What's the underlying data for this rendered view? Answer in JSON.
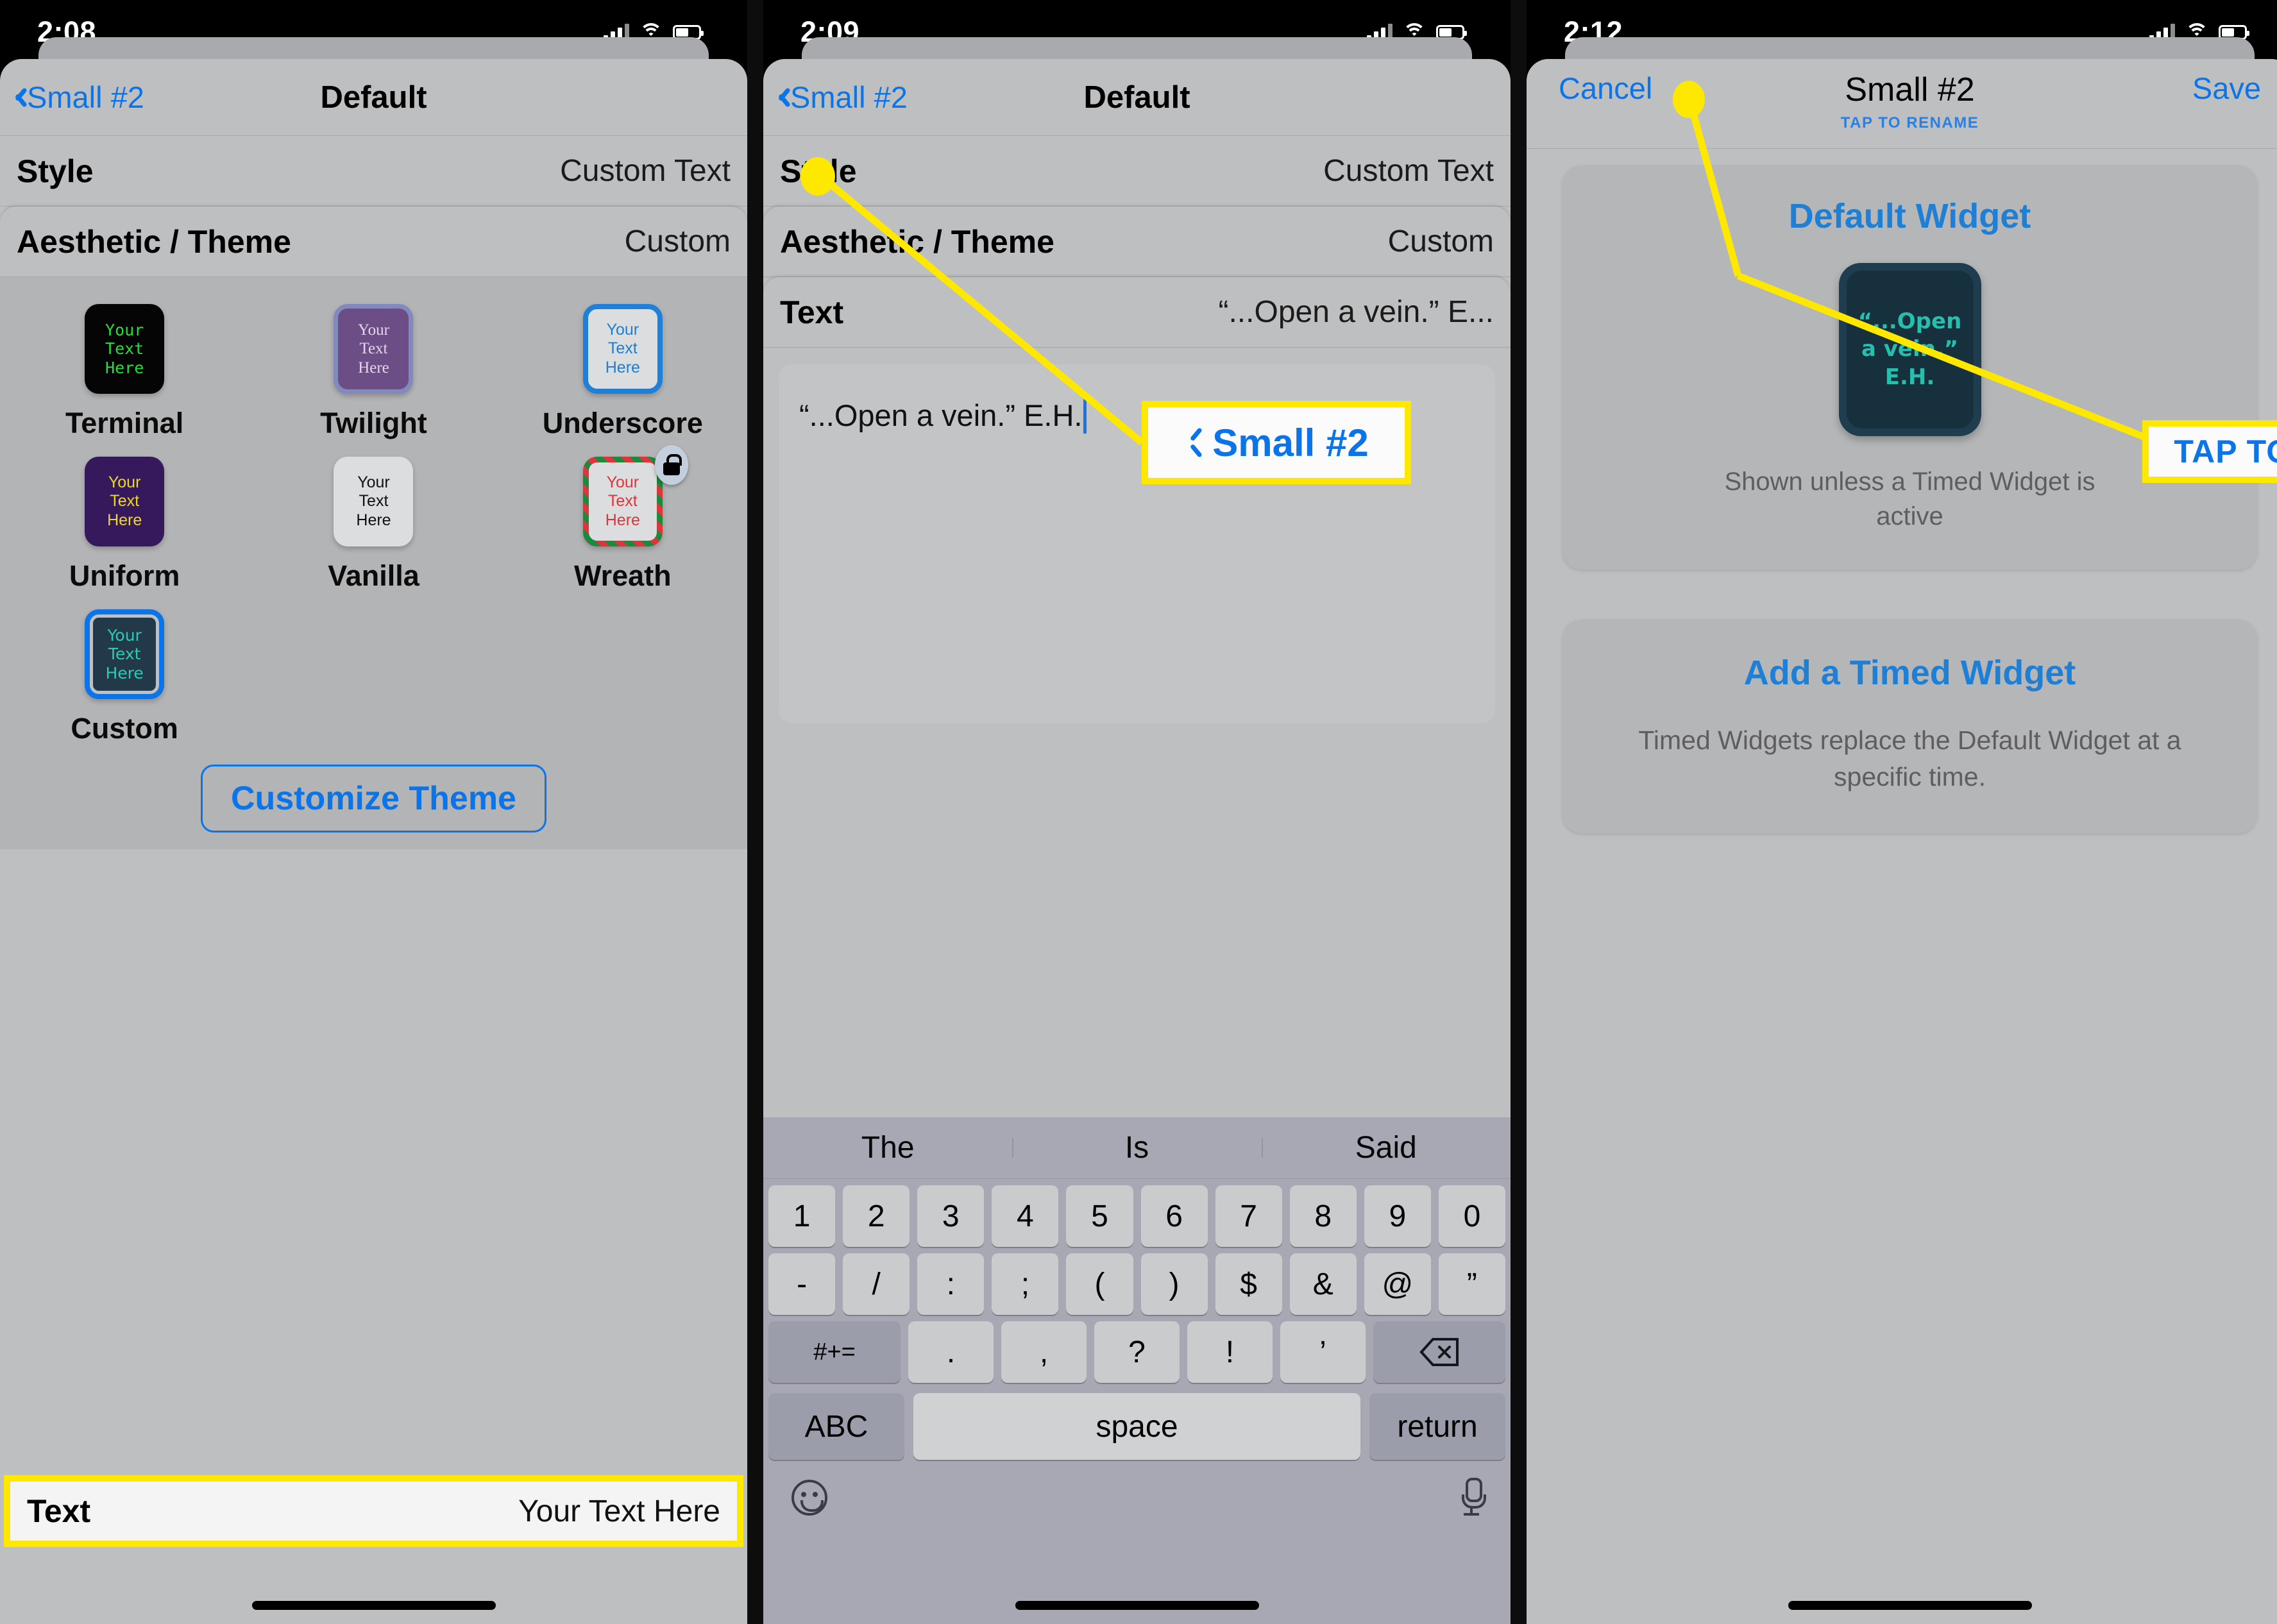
{
  "panels": [
    {
      "status": {
        "time": "2:08"
      },
      "nav": {
        "back_label": "Small #2",
        "title": "Default"
      },
      "rows": [
        {
          "key": "Style",
          "value": "Custom Text"
        },
        {
          "key": "Aesthetic / Theme",
          "value": "Custom"
        }
      ],
      "themes": [
        {
          "name": "Terminal",
          "sample": [
            "Your",
            "Text",
            "Here"
          ]
        },
        {
          "name": "Twilight",
          "sample": [
            "Your",
            "Text",
            "Here"
          ]
        },
        {
          "name": "Underscore",
          "sample": [
            "Your",
            "Text",
            "Here"
          ]
        },
        {
          "name": "Uniform",
          "sample": [
            "Your",
            "Text",
            "Here"
          ]
        },
        {
          "name": "Vanilla",
          "sample": [
            "Your",
            "Text",
            "Here"
          ]
        },
        {
          "name": "Wreath",
          "sample": [
            "Your",
            "Text",
            "Here"
          ],
          "locked": true
        },
        {
          "name": "Custom",
          "sample": [
            "Your",
            "Text",
            "Here"
          ],
          "selected": true
        }
      ],
      "customize_label": "Customize Theme",
      "text_row": {
        "key": "Text",
        "value": "Your Text Here"
      }
    },
    {
      "status": {
        "time": "2:09"
      },
      "nav": {
        "back_label": "Small #2",
        "title": "Default"
      },
      "rows": [
        {
          "key": "Style",
          "value": "Custom Text"
        },
        {
          "key": "Aesthetic / Theme",
          "value": "Custom"
        },
        {
          "key": "Text",
          "value": "“...Open a vein.” E..."
        }
      ],
      "callout": {
        "label": "Small #2"
      },
      "editor": {
        "value": "“...Open a vein.” E.H."
      },
      "keyboard": {
        "predictions": [
          "The",
          "Is",
          "Said"
        ],
        "row_numbers": [
          "1",
          "2",
          "3",
          "4",
          "5",
          "6",
          "7",
          "8",
          "9",
          "0"
        ],
        "row_symbols": [
          "-",
          "/",
          ":",
          ";",
          "(",
          ")",
          "$",
          "&",
          "@",
          "”"
        ],
        "row_punct": [
          "#+=",
          ".",
          ",",
          "?",
          "!",
          "’",
          "backspace-icon"
        ],
        "bottom": {
          "abc": "ABC",
          "space": "space",
          "return": "return"
        },
        "emoji_icon": "emoji-icon",
        "mic_icon": "microphone-icon"
      }
    },
    {
      "status": {
        "time": "2:12"
      },
      "nav": {
        "cancel": "Cancel",
        "title": "Small #2",
        "save": "Save",
        "subtitle": "TAP TO RENAME"
      },
      "default_widget": {
        "heading": "Default Widget",
        "preview_lines": [
          "“...Open",
          "a vein.”",
          "E.H."
        ],
        "note": "Shown unless a Timed Widget is active"
      },
      "timed_widget": {
        "heading": "Add a Timed Widget",
        "note": "Timed Widgets replace the Default Widget at a specific time."
      },
      "callout": {
        "label": "TAP TO RENAME"
      }
    }
  ],
  "colors": {
    "accent_blue": "#0a74e8",
    "highlight_yellow": "#ffe800",
    "sheet_gray": "#bebfc1",
    "teal": "#26bfad"
  }
}
